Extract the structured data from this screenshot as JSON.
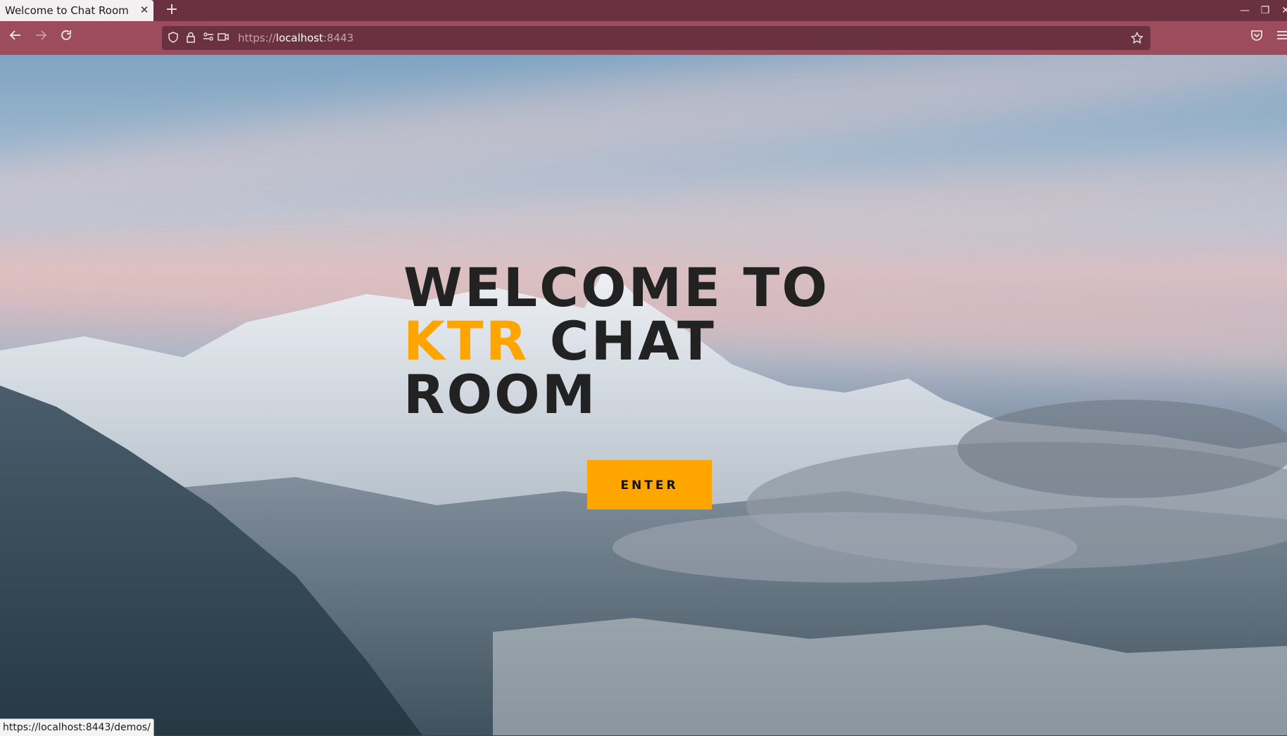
{
  "browser": {
    "tab_title": "Welcome to Chat Room",
    "tab_close_icon": "close-icon",
    "new_tab_label": "+",
    "window_controls": [
      "minimize-icon",
      "restore-icon",
      "close-icon"
    ],
    "nav": {
      "back_icon": "arrow-left-icon",
      "forward_icon": "arrow-right-icon",
      "reload_icon": "reload-icon"
    },
    "url_prefix": "https://",
    "url_host": "localhost",
    "url_port": ":8443",
    "status_url": "https://localhost:8443/demos/",
    "colors": {
      "tabbar": "#6a3240",
      "toolbar": "#9c4c5d",
      "urlbar": "#6a3240"
    }
  },
  "hero": {
    "line1": "WELCOME TO",
    "line2_accent": "KTR",
    "line2_rest": " CHAT",
    "line3": "ROOM",
    "enter_label": "ENTER",
    "accent_color": "#ffa500",
    "text_color": "#222222"
  }
}
